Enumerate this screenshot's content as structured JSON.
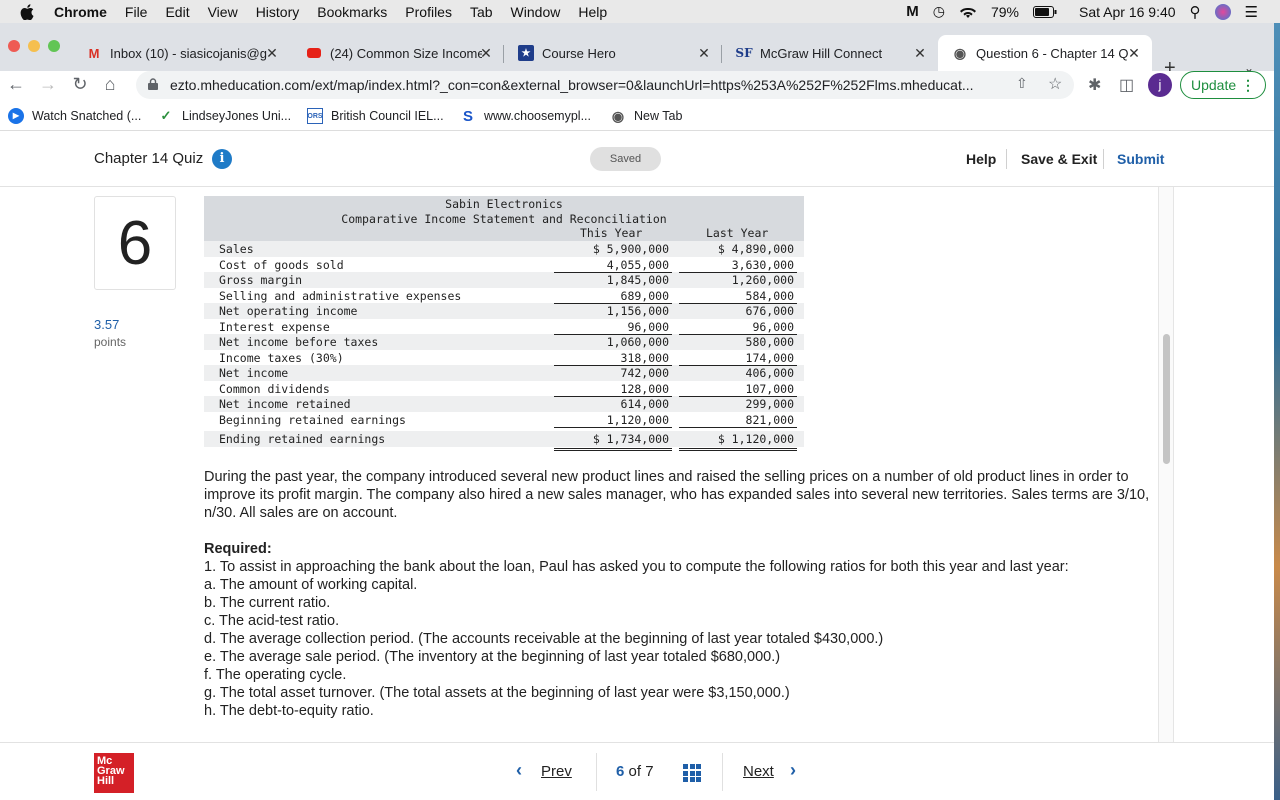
{
  "menubar": {
    "app": "Chrome",
    "items": [
      "File",
      "Edit",
      "View",
      "History",
      "Bookmarks",
      "Profiles",
      "Tab",
      "Window",
      "Help"
    ],
    "battery": "79%",
    "datetime": "Sat Apr 16  9:40"
  },
  "tabs": [
    {
      "title": "Inbox (10) - siasicojanis@g",
      "icon": "gmail-icon",
      "active": false
    },
    {
      "title": "(24) Common Size Income",
      "icon": "youtube-icon",
      "active": false
    },
    {
      "title": "Course Hero",
      "icon": "coursehero-icon",
      "active": false
    },
    {
      "title": "McGraw Hill Connect",
      "icon": "connect-icon",
      "active": false
    },
    {
      "title": "Question 6 - Chapter 14 Q",
      "icon": "globe-icon",
      "active": true
    }
  ],
  "toolbar": {
    "url": "ezto.mheducation.com/ext/map/index.html?_con=con&external_browser=0&launchUrl=https%253A%252F%252Flms.mheducat...",
    "profile_initial": "j",
    "update_label": "Update"
  },
  "bookmarks": [
    "Watch Snatched (...",
    "LindseyJones Uni...",
    "British Council IEL...",
    "www.choosemypl...",
    "New Tab"
  ],
  "quiz": {
    "title": "Chapter 14 Quiz",
    "saved_label": "Saved",
    "help_label": "Help",
    "save_exit_label": "Save & Exit",
    "submit_label": "Submit"
  },
  "question": {
    "number": "6",
    "points": "3.57",
    "points_label": "points"
  },
  "statement": {
    "company": "Sabin Electronics",
    "title": "Comparative Income Statement and Reconciliation",
    "col_this": "This Year",
    "col_last": "Last Year",
    "rows": [
      {
        "label": "Sales",
        "this": "$ 5,900,000",
        "last": "$ 4,890,000"
      },
      {
        "label": "Cost of goods sold",
        "this": "4,055,000",
        "last": "3,630,000"
      },
      {
        "label": "Gross margin",
        "this": "1,845,000",
        "last": "1,260,000"
      },
      {
        "label": "Selling and administrative expenses",
        "this": "689,000",
        "last": "584,000"
      },
      {
        "label": "Net operating income",
        "this": "1,156,000",
        "last": "676,000"
      },
      {
        "label": "Interest expense",
        "this": "96,000",
        "last": "96,000"
      },
      {
        "label": "Net income before taxes",
        "this": "1,060,000",
        "last": "580,000"
      },
      {
        "label": "Income taxes (30%)",
        "this": "318,000",
        "last": "174,000"
      },
      {
        "label": "Net income",
        "this": "742,000",
        "last": "406,000"
      },
      {
        "label": "Common dividends",
        "this": "128,000",
        "last": "107,000"
      },
      {
        "label": "Net income retained",
        "this": "614,000",
        "last": "299,000"
      },
      {
        "label": "Beginning retained earnings",
        "this": "1,120,000",
        "last": "821,000"
      },
      {
        "label": "Ending retained earnings",
        "this": "$ 1,734,000",
        "last": "$ 1,120,000"
      }
    ]
  },
  "body": {
    "intro": "During the past year, the company introduced several new product lines and raised the selling prices on a number of old product lines in order to improve its profit margin. The company also hired a new sales manager, who has expanded sales into several new territories. Sales terms are 3/10, n/30. All sales are on account.",
    "required_label": "Required:",
    "lines": [
      "1. To assist in approaching the bank about the loan, Paul has asked you to compute the following ratios for both this year and last year:",
      "a. The amount of working capital.",
      "b. The current ratio.",
      "c. The acid-test ratio.",
      "d. The average collection period. (The accounts receivable at the beginning of last year totaled $430,000.)",
      "e. The average sale period. (The inventory at the beginning of last year totaled $680,000.)",
      "f. The operating cycle.",
      "g. The total asset turnover. (The total assets at the beginning of last year were $3,150,000.)",
      "h. The debt-to-equity ratio."
    ]
  },
  "footer": {
    "logo_lines": [
      "Mc",
      "Graw",
      "Hill"
    ],
    "prev_label": "Prev",
    "next_label": "Next",
    "current_page": "6",
    "of_label": "of",
    "total_pages": "7"
  }
}
